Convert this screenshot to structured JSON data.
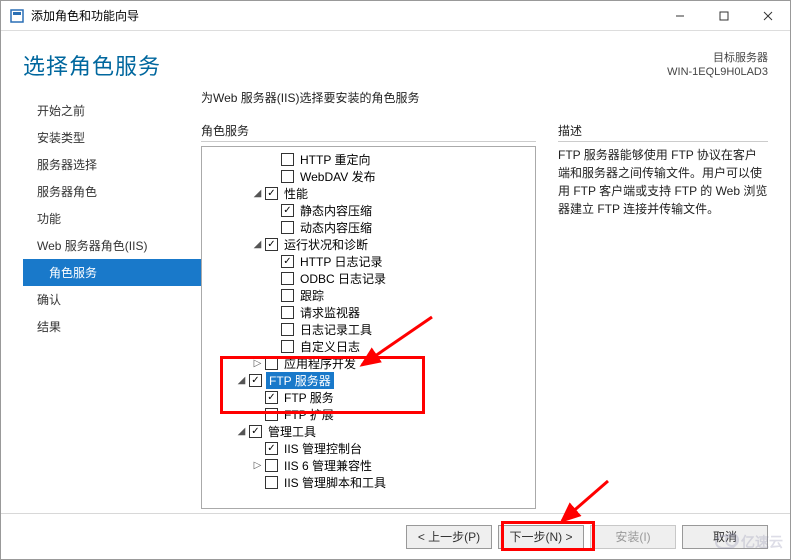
{
  "titlebar": {
    "title": "添加角色和功能向导"
  },
  "header": {
    "page_title": "选择角色服务",
    "target_label": "目标服务器",
    "target_name": "WIN-1EQL9H0LAD3"
  },
  "sidebar": {
    "steps": [
      {
        "label": "开始之前",
        "selected": false,
        "sub": false
      },
      {
        "label": "安装类型",
        "selected": false,
        "sub": false
      },
      {
        "label": "服务器选择",
        "selected": false,
        "sub": false
      },
      {
        "label": "服务器角色",
        "selected": false,
        "sub": false
      },
      {
        "label": "功能",
        "selected": false,
        "sub": false
      },
      {
        "label": "Web 服务器角色(IIS)",
        "selected": false,
        "sub": false
      },
      {
        "label": "角色服务",
        "selected": true,
        "sub": true
      },
      {
        "label": "确认",
        "selected": false,
        "sub": false
      },
      {
        "label": "结果",
        "selected": false,
        "sub": false
      }
    ]
  },
  "content": {
    "heading": "为Web 服务器(IIS)选择要安装的角色服务",
    "roles_label": "角色服务",
    "desc_label": "描述",
    "description": "FTP 服务器能够使用 FTP 协议在客户端和服务器之间传输文件。用户可以使用 FTP 客户端或支持 FTP 的 Web 浏览器建立 FTP 连接并传输文件。"
  },
  "tree": [
    {
      "indent": 4,
      "exp": "",
      "cb": "empty",
      "text": "HTTP 重定向"
    },
    {
      "indent": 4,
      "exp": "",
      "cb": "empty",
      "text": "WebDAV 发布"
    },
    {
      "indent": 3,
      "exp": "down",
      "cb": "checked",
      "text": "性能"
    },
    {
      "indent": 4,
      "exp": "",
      "cb": "checked",
      "text": "静态内容压缩"
    },
    {
      "indent": 4,
      "exp": "",
      "cb": "empty",
      "text": "动态内容压缩"
    },
    {
      "indent": 3,
      "exp": "down",
      "cb": "checked",
      "text": "运行状况和诊断"
    },
    {
      "indent": 4,
      "exp": "",
      "cb": "checked",
      "text": "HTTP 日志记录"
    },
    {
      "indent": 4,
      "exp": "",
      "cb": "empty",
      "text": "ODBC 日志记录"
    },
    {
      "indent": 4,
      "exp": "",
      "cb": "empty",
      "text": "跟踪"
    },
    {
      "indent": 4,
      "exp": "",
      "cb": "empty",
      "text": "请求监视器"
    },
    {
      "indent": 4,
      "exp": "",
      "cb": "empty",
      "text": "日志记录工具"
    },
    {
      "indent": 4,
      "exp": "",
      "cb": "empty",
      "text": "自定义日志"
    },
    {
      "indent": 3,
      "exp": "right",
      "cb": "empty",
      "text": "应用程序开发"
    },
    {
      "indent": 2,
      "exp": "down",
      "cb": "checked",
      "text": "FTP 服务器",
      "selected": true
    },
    {
      "indent": 3,
      "exp": "",
      "cb": "checked",
      "text": "FTP 服务"
    },
    {
      "indent": 3,
      "exp": "",
      "cb": "empty",
      "text": "FTP 扩展"
    },
    {
      "indent": 2,
      "exp": "down",
      "cb": "checked",
      "text": "管理工具"
    },
    {
      "indent": 3,
      "exp": "",
      "cb": "checked",
      "text": "IIS 管理控制台"
    },
    {
      "indent": 3,
      "exp": "right",
      "cb": "empty",
      "text": "IIS 6 管理兼容性"
    },
    {
      "indent": 3,
      "exp": "",
      "cb": "empty",
      "text": "IIS 管理脚本和工具"
    }
  ],
  "footer": {
    "prev": "< 上一步(P)",
    "next": "下一步(N) >",
    "install": "安装(I)",
    "cancel": "取消"
  },
  "watermark": "亿速云"
}
